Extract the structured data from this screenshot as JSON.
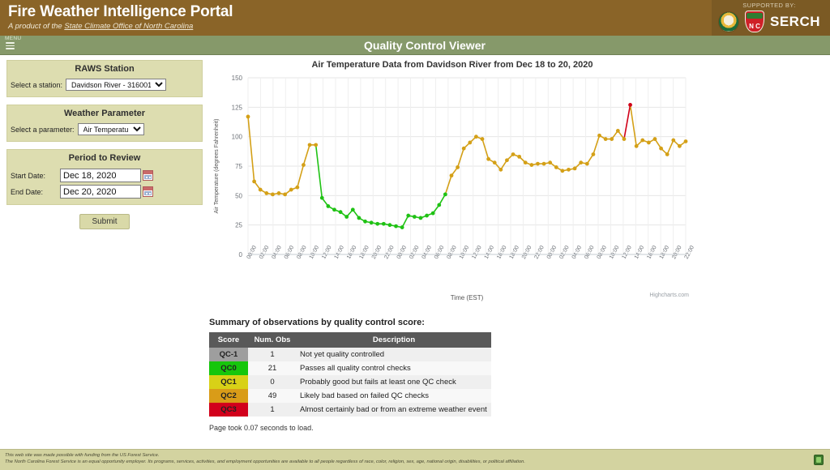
{
  "header": {
    "title": "Fire Weather Intelligence Portal",
    "subtitle_prefix": "A product of the ",
    "subtitle_link": "State Climate Office of North Carolina",
    "supported_label": "Supported By:",
    "serch_text": "SERCH"
  },
  "subheader": {
    "menu_label": "MENU",
    "page_title": "Quality Control Viewer"
  },
  "form": {
    "station_panel_title": "RAWS Station",
    "station_label": "Select a station:",
    "station_value": "Davidson River - 316001",
    "parameter_panel_title": "Weather Parameter",
    "parameter_label": "Select a parameter:",
    "parameter_value": "Air Temperature",
    "period_panel_title": "Period to Review",
    "start_date_label": "Start Date:",
    "start_date_value": "Dec 18, 2020",
    "end_date_label": "End Date:",
    "end_date_value": "Dec 20, 2020",
    "submit_label": "Submit"
  },
  "chart_data": {
    "type": "line",
    "title": "Air Temperature Data from Davidson River from Dec 18 to 20, 2020",
    "xlabel": "Time (EST)",
    "ylabel": "Air Temperature (degrees Fahrenheit)",
    "ylim": [
      0,
      150
    ],
    "yticks": [
      0,
      25,
      50,
      75,
      100,
      125,
      150
    ],
    "grid": true,
    "legend": "none",
    "credit": "Highcharts.com",
    "xticks": [
      "00:00",
      "02:00",
      "04:00",
      "06:00",
      "08:00",
      "10:00",
      "12:00",
      "14:00",
      "16:00",
      "18:00",
      "20:00",
      "22:00",
      "00:00",
      "02:00",
      "04:00",
      "06:00",
      "08:00",
      "10:00",
      "12:00",
      "14:00",
      "16:00",
      "18:00",
      "20:00",
      "22:00",
      "00:00",
      "02:00",
      "04:00",
      "06:00",
      "08:00",
      "10:00",
      "12:00",
      "14:00",
      "16:00",
      "18:00",
      "20:00",
      "22:00"
    ],
    "point_colors": {
      "QC-1": "#9e9e9e",
      "QC0": "#1fc214",
      "QC1": "#e3e32a",
      "QC2": "#d4a017",
      "QC3": "#d00018"
    },
    "series": [
      {
        "name": "Air Temperature",
        "values": [
          117,
          62,
          55,
          52,
          51,
          52,
          51,
          55,
          57,
          76,
          93,
          93,
          48,
          41,
          38,
          36,
          32,
          38,
          31,
          28,
          27,
          26,
          26,
          25,
          24,
          23,
          33,
          32,
          31,
          33,
          35,
          42,
          51,
          67,
          74,
          90,
          95,
          100,
          98,
          81,
          78,
          72,
          80,
          85,
          83,
          78,
          76,
          77,
          77,
          78,
          74,
          71,
          72,
          73,
          78,
          77,
          85,
          101,
          98,
          98,
          105,
          98,
          127,
          92,
          97,
          95,
          98,
          90,
          85,
          97,
          92,
          96
        ],
        "qc": [
          "QC2",
          "QC2",
          "QC2",
          "QC2",
          "QC2",
          "QC2",
          "QC2",
          "QC2",
          "QC2",
          "QC2",
          "QC2",
          "QC2",
          "QC0",
          "QC0",
          "QC0",
          "QC0",
          "QC0",
          "QC0",
          "QC0",
          "QC0",
          "QC0",
          "QC0",
          "QC0",
          "QC0",
          "QC0",
          "QC0",
          "QC0",
          "QC0",
          "QC0",
          "QC0",
          "QC0",
          "QC0",
          "QC0",
          "QC2",
          "QC2",
          "QC2",
          "QC2",
          "QC2",
          "QC2",
          "QC2",
          "QC2",
          "QC2",
          "QC2",
          "QC2",
          "QC2",
          "QC2",
          "QC2",
          "QC2",
          "QC2",
          "QC2",
          "QC2",
          "QC2",
          "QC2",
          "QC2",
          "QC2",
          "QC2",
          "QC2",
          "QC2",
          "QC2",
          "QC2",
          "QC2",
          "QC2",
          "QC3",
          "QC2",
          "QC2",
          "QC2",
          "QC2",
          "QC2",
          "QC2",
          "QC2",
          "QC2",
          "QC2"
        ]
      }
    ]
  },
  "summary": {
    "title": "Summary of observations by quality control score:",
    "columns": [
      "Score",
      "Num. Obs",
      "Description"
    ],
    "rows": [
      {
        "score": "QC-1",
        "color": "#9e9e9e",
        "num": "1",
        "desc": "Not yet quality controlled"
      },
      {
        "score": "QC0",
        "color": "#16c60c",
        "num": "21",
        "desc": "Passes all quality control checks"
      },
      {
        "score": "QC1",
        "color": "#d8d117",
        "num": "0",
        "desc": "Probably good but fails at least one QC check"
      },
      {
        "score": "QC2",
        "color": "#d99c18",
        "num": "49",
        "desc": "Likely bad based on failed QC checks"
      },
      {
        "score": "QC3",
        "color": "#d2001c",
        "num": "1",
        "desc": "Almost certainly bad or from an extreme weather event"
      }
    ],
    "page_time": "Page took 0.07 seconds to load."
  },
  "footer": {
    "line1": "This web site was made possible with funding from the US Forest Service.",
    "line2": "The North Carolina Forest Service is an equal opportunity employer. Its programs, services, activities, and employment opportunities are available to all people regardless of race, color, religion, sex, age, national origin, disabilities, or political affiliation."
  }
}
